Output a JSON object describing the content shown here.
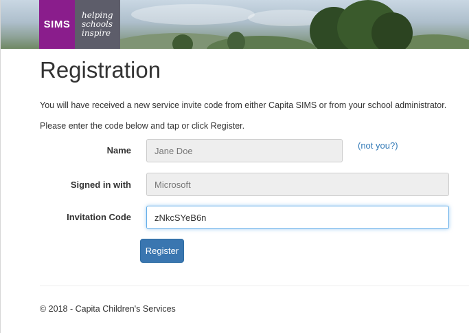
{
  "header": {
    "logo_text": "SIMS",
    "tagline": [
      "helping",
      "schools",
      "inspire"
    ],
    "brand_color": "#8a1d8c"
  },
  "main": {
    "title": "Registration",
    "intro_1": "You will have received a new service invite code from either Capita SIMS or from your school administrator.",
    "intro_2": "Please enter the code below and tap or click Register."
  },
  "form": {
    "name_label": "Name",
    "name_value": "Jane Doe",
    "not_you_link": "(not you?)",
    "signed_in_label": "Signed in with",
    "signed_in_value": "Microsoft",
    "code_label": "Invitation Code",
    "code_value": "zNkcSYeB6n",
    "register_label": "Register",
    "primary_color": "#3a76b0",
    "link_color": "#337ab7"
  },
  "footer": {
    "copyright": "© 2018 - Capita Children's Services"
  }
}
